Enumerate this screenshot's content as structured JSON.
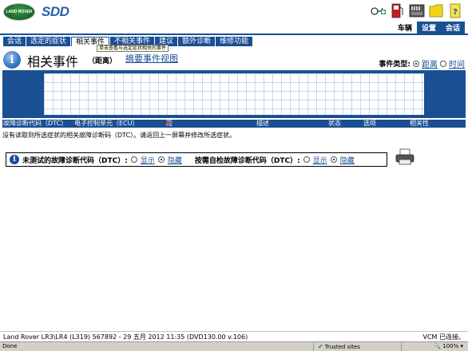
{
  "header": {
    "logo_text": "LAND ROVER",
    "app_name": "SDD",
    "icons": [
      "stethoscope-icon",
      "fuel-pump-icon",
      "bookshelf-icon",
      "folder-icon",
      "help-icon"
    ],
    "nav": [
      "车辆",
      "设置",
      "会话"
    ]
  },
  "tabs": [
    "会话",
    "选定的症状",
    "相关事件",
    "不相关事件",
    "建议",
    "额外诊断",
    "维修功能"
  ],
  "tooltip": "单击查看与选定症状相关的事件",
  "title": "相关事件",
  "subtitle": "（距离）",
  "summary_link": "摘要事件视图",
  "event_type": {
    "label": "事件类型:",
    "options": [
      "距离",
      "时间"
    ],
    "selected": "距离"
  },
  "table_headers": [
    "故障诊断代码（DTC）",
    "电子控制单元（ECU）",
    "距离",
    "描述",
    "状态",
    "选项",
    "相关性"
  ],
  "message": "没有读取到所选症状的相关故障诊断码（DTC）。请返回上一屏幕并修改所选症状。",
  "filters": {
    "untested_label": "未测试的故障诊断代码（DTC）:",
    "selftest_label": "按需自检故障诊断代码（DTC）:",
    "show": "显示",
    "hide": "隐藏",
    "untested_selected": "隐藏",
    "selftest_selected": "隐藏"
  },
  "footer": {
    "vehicle": "Land Rover LR3\\LR4 (L319) 567892 - 29 五月 2012 11:35 (DVD130.00 v.106)",
    "vcm_status": "VCM 已连接。"
  },
  "browser": {
    "status": "Done",
    "zone": "Trusted sites",
    "zoom": "100%"
  },
  "colors": {
    "accent": "#1a4f94",
    "sort_arrow": "#e33"
  }
}
